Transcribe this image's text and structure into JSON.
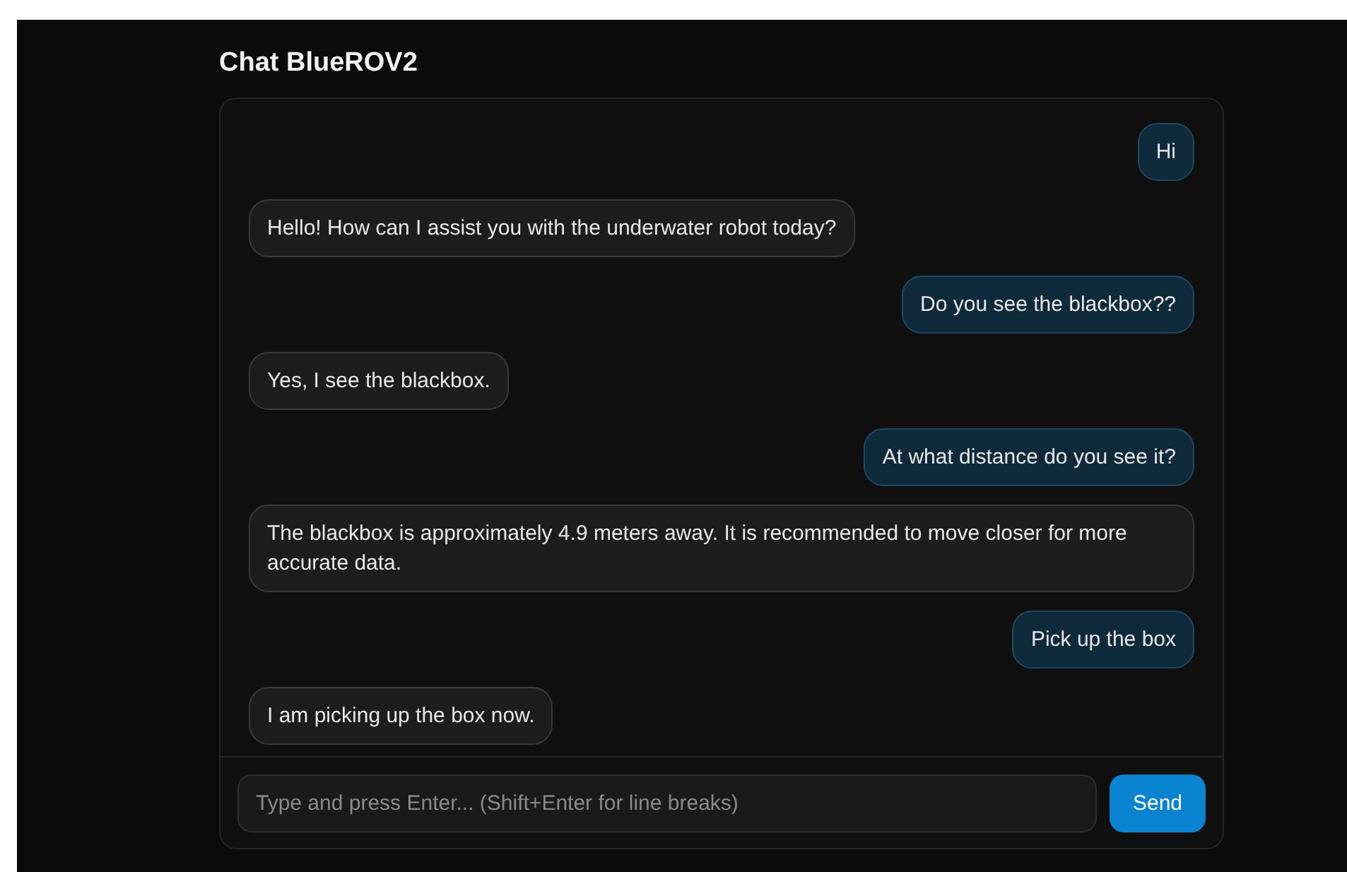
{
  "title": "Chat BlueROV2",
  "messages": [
    {
      "kind": "user",
      "text": "Hi"
    },
    {
      "kind": "assistant",
      "text": "Hello! How can I assist you with the underwater robot today?"
    },
    {
      "kind": "user",
      "text": "Do you see the blackbox??"
    },
    {
      "kind": "assistant",
      "text": "Yes, I see the blackbox."
    },
    {
      "kind": "user",
      "text": "At what distance do you see it?"
    },
    {
      "kind": "assistant",
      "text": "The blackbox is approximately 4.9 meters away. It is recommended to move closer for more accurate data."
    },
    {
      "kind": "user",
      "text": "Pick up the box"
    },
    {
      "kind": "assistant",
      "text": "I am picking up the box now."
    }
  ],
  "input": {
    "placeholder": "Type and press Enter... (Shift+Enter for line breaks)"
  },
  "send_button": "Send"
}
